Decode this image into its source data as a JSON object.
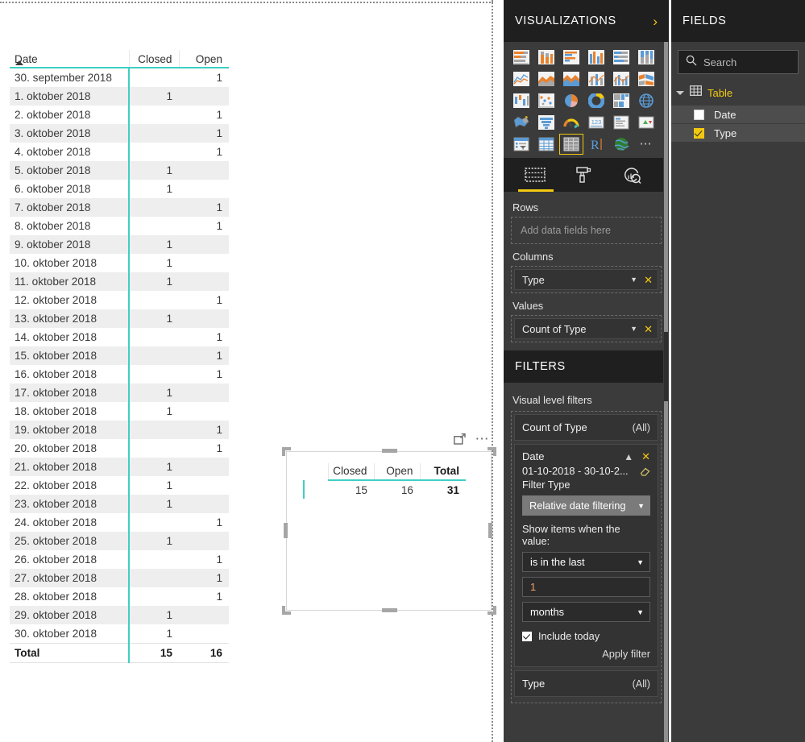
{
  "canvas": {
    "matrix_visual": {
      "columns": [
        "Date",
        "Closed",
        "Open"
      ],
      "sort_column": "Date",
      "rows": [
        {
          "date": "30. september 2018",
          "closed": "",
          "open": "1"
        },
        {
          "date": "1. oktober 2018",
          "closed": "1",
          "open": ""
        },
        {
          "date": "2. oktober 2018",
          "closed": "",
          "open": "1"
        },
        {
          "date": "3. oktober 2018",
          "closed": "",
          "open": "1"
        },
        {
          "date": "4. oktober 2018",
          "closed": "",
          "open": "1"
        },
        {
          "date": "5. oktober 2018",
          "closed": "1",
          "open": ""
        },
        {
          "date": "6. oktober 2018",
          "closed": "1",
          "open": ""
        },
        {
          "date": "7. oktober 2018",
          "closed": "",
          "open": "1"
        },
        {
          "date": "8. oktober 2018",
          "closed": "",
          "open": "1"
        },
        {
          "date": "9. oktober 2018",
          "closed": "1",
          "open": ""
        },
        {
          "date": "10. oktober 2018",
          "closed": "1",
          "open": ""
        },
        {
          "date": "11. oktober 2018",
          "closed": "1",
          "open": ""
        },
        {
          "date": "12. oktober 2018",
          "closed": "",
          "open": "1"
        },
        {
          "date": "13. oktober 2018",
          "closed": "1",
          "open": ""
        },
        {
          "date": "14. oktober 2018",
          "closed": "",
          "open": "1"
        },
        {
          "date": "15. oktober 2018",
          "closed": "",
          "open": "1"
        },
        {
          "date": "16. oktober 2018",
          "closed": "",
          "open": "1"
        },
        {
          "date": "17. oktober 2018",
          "closed": "1",
          "open": ""
        },
        {
          "date": "18. oktober 2018",
          "closed": "1",
          "open": ""
        },
        {
          "date": "19. oktober 2018",
          "closed": "",
          "open": "1"
        },
        {
          "date": "20. oktober 2018",
          "closed": "",
          "open": "1"
        },
        {
          "date": "21. oktober 2018",
          "closed": "1",
          "open": ""
        },
        {
          "date": "22. oktober 2018",
          "closed": "1",
          "open": ""
        },
        {
          "date": "23. oktober 2018",
          "closed": "1",
          "open": ""
        },
        {
          "date": "24. oktober 2018",
          "closed": "",
          "open": "1"
        },
        {
          "date": "25. oktober 2018",
          "closed": "1",
          "open": ""
        },
        {
          "date": "26. oktober 2018",
          "closed": "",
          "open": "1"
        },
        {
          "date": "27. oktober 2018",
          "closed": "",
          "open": "1"
        },
        {
          "date": "28. oktober 2018",
          "closed": "",
          "open": "1"
        },
        {
          "date": "29. oktober 2018",
          "closed": "1",
          "open": ""
        },
        {
          "date": "30. oktober 2018",
          "closed": "1",
          "open": ""
        }
      ],
      "total": {
        "label": "Total",
        "closed": "15",
        "open": "16"
      }
    },
    "selected_visual": {
      "headers": [
        "Closed",
        "Open",
        "Total"
      ],
      "values": [
        "15",
        "16",
        "31"
      ]
    }
  },
  "visualizations": {
    "title": "VISUALIZATIONS",
    "expand_icon": "chevron-right-icon",
    "gallery": [
      "stacked-bar-chart",
      "stacked-column-chart",
      "clustered-bar-chart",
      "clustered-column-chart",
      "100-percent-stacked-bar-chart",
      "100-percent-stacked-column-chart",
      "line-chart",
      "area-chart",
      "stacked-area-chart",
      "line-and-stacked-column-chart",
      "line-and-clustered-column-chart",
      "ribbon-chart",
      "waterfall-chart",
      "scatter-chart",
      "pie-chart",
      "donut-chart",
      "treemap",
      "map",
      "filled-map",
      "funnel",
      "gauge",
      "card",
      "multi-row-card",
      "kpi",
      "slicer",
      "table",
      "matrix",
      "r-script-visual",
      "arcgis-map",
      "more-visuals"
    ],
    "selected_gallery_item": "matrix",
    "tabs": [
      "fields-pane-tab",
      "format-pane-tab",
      "analytics-pane-tab"
    ],
    "active_tab": "fields-pane-tab",
    "wells": [
      {
        "label": "Rows",
        "placeholder": "Add data fields here",
        "chips": []
      },
      {
        "label": "Columns",
        "placeholder": "",
        "chips": [
          "Type"
        ]
      },
      {
        "label": "Values",
        "placeholder": "",
        "chips": [
          "Count of Type"
        ]
      }
    ]
  },
  "filters": {
    "title": "FILTERS",
    "section_label": "Visual level filters",
    "cards": [
      {
        "name": "Count of Type",
        "scope": "(All)"
      }
    ],
    "date_filter": {
      "name": "Date",
      "range": "01-10-2018 - 30-10-2...",
      "filter_type_label": "Filter Type",
      "filter_type_value": "Relative date filtering",
      "prompt": "Show items when the value:",
      "condition": "is in the last",
      "amount": "1",
      "unit": "months",
      "include_today_label": "Include today",
      "include_today_checked": true,
      "apply_label": "Apply filter"
    },
    "type_filter": {
      "name": "Type",
      "scope": "(All)"
    }
  },
  "fields": {
    "title": "FIELDS",
    "search_placeholder": "Search",
    "search_icon": "search-icon",
    "tables": [
      {
        "name": "Table",
        "expanded": true,
        "fields": [
          {
            "name": "Date",
            "checked": false
          },
          {
            "name": "Type",
            "checked": true
          }
        ]
      }
    ]
  },
  "colors": {
    "accent_teal": "#3fcfc4",
    "brand_yellow": "#f2c811",
    "pane_bg": "#3b3b3b",
    "pane_header_bg": "#1f1f1f"
  }
}
